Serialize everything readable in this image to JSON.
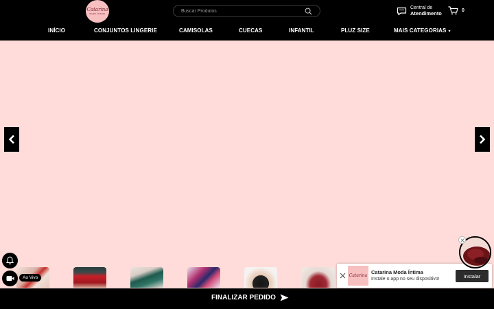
{
  "header": {
    "logo": {
      "script": "Catarina",
      "sub": "MODA ÍNTIMA"
    },
    "search": {
      "placeholder": "Buscar Produtos"
    },
    "support": {
      "line1": "Central de",
      "line2": "Atendimento"
    },
    "cart": {
      "count": "0"
    }
  },
  "nav": {
    "items": [
      {
        "label": "INÍCIO"
      },
      {
        "label": "CONJUNTOS LINGERIE"
      },
      {
        "label": "CAMISOLAS"
      },
      {
        "label": "CUECAS"
      },
      {
        "label": "INFANTIL"
      },
      {
        "label": "PLUZ SIZE"
      },
      {
        "label": "MAIS CATEGORIAS"
      }
    ]
  },
  "floating": {
    "live_label": "Ao Vivo"
  },
  "bottom_bar": {
    "finalize_label": "FINALIZAR PEDIDO"
  },
  "install_banner": {
    "logo_script": "Catarina",
    "title": "Catarina Moda Íntima",
    "description": "Instale o app no seu dispositivo!",
    "button_label": "Instalar"
  },
  "colors": {
    "background": "#ffdcd9",
    "header": "#000000",
    "logo_pink": "#f7bfc0"
  }
}
